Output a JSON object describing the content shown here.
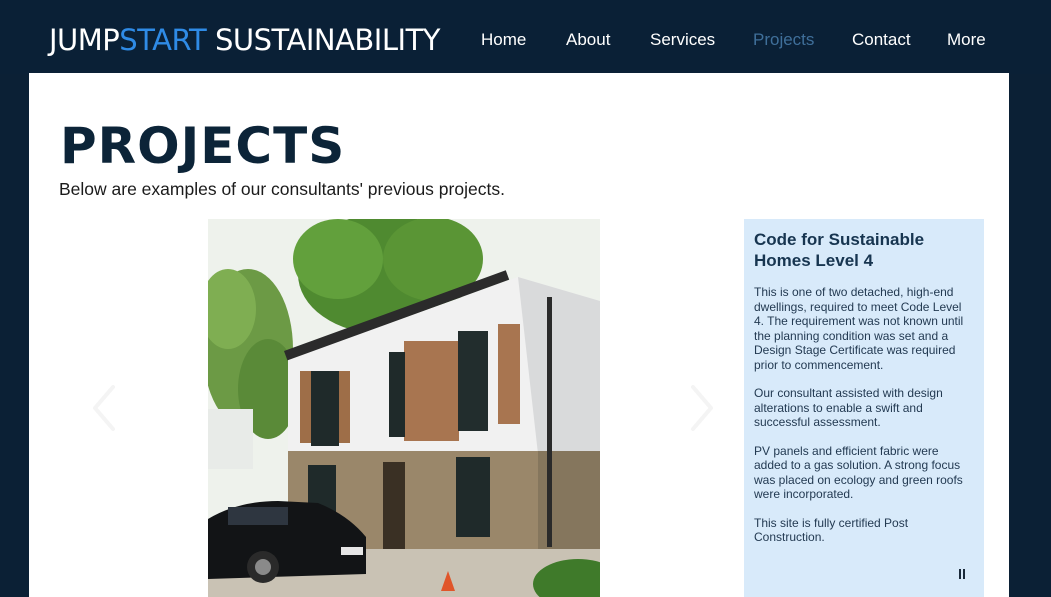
{
  "header": {
    "logo_part1": "JUMP",
    "logo_part2": "START",
    "logo_part3": " SUSTAINABILITY",
    "nav": [
      {
        "label": "Home",
        "active": false
      },
      {
        "label": "About",
        "active": false
      },
      {
        "label": "Services",
        "active": false
      },
      {
        "label": "Projects",
        "active": true
      },
      {
        "label": "Contact",
        "active": false
      },
      {
        "label": "More",
        "active": false
      }
    ]
  },
  "main": {
    "title": "PROJECTS",
    "subtitle": "Below are examples of our consultants' previous projects."
  },
  "slideshow": {
    "prev_icon": "chevron-left-icon",
    "next_icon": "chevron-right-icon",
    "pause_icon": "pause-icon",
    "info": {
      "title": "Code for Sustainable Homes Level 4",
      "paragraphs": [
        "This is one of two detached, high-end dwellings, required to meet Code Level 4. The requirement was not known until the planning condition was set and a Design Stage Certificate was required prior to commencement.",
        "Our consultant assisted with design alterations to enable a swift and successful assessment.",
        "PV panels and efficient fabric were added to a gas solution. A strong focus was placed on ecology and green roofs were incorporated.",
        "This site is fully certified Post Construction."
      ]
    }
  },
  "colors": {
    "header_bg": "#0a2036",
    "accent": "#2f8be6",
    "active_nav": "#3f6f9a",
    "panel_bg": "#d8eafa"
  }
}
